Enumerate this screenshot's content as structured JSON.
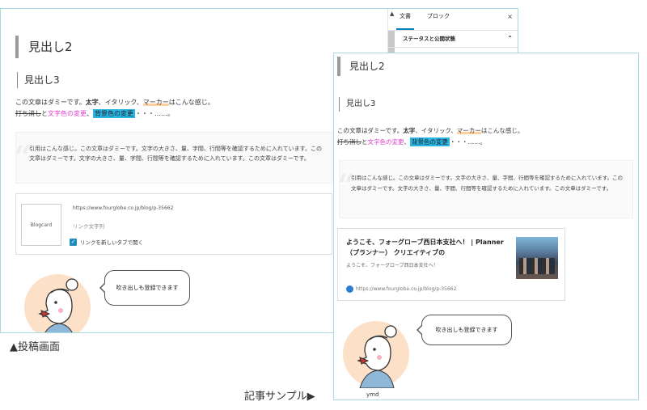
{
  "editor": {
    "heading2": "見出し2",
    "heading3": "見出し3",
    "paragraph1": {
      "a": "この文章はダミーです。",
      "bold": "太字",
      "b": "、イタリック、",
      "marker": "マーカー",
      "c": "はこんな感じ。"
    },
    "paragraph2": {
      "strike": "打ち消し",
      "a": "と",
      "color": "文字色の変更",
      "b": "、",
      "bg": "背景色の変更",
      "c": "・・・……。"
    },
    "quote": "引用はこんな感じ。この文章はダミーです。文字の大きさ、量、字間、行間等を確認するために入れています。この文章はダミーです。文字の大きさ、量、字間、行間等を確認するために入れています。この文章はダミーです。",
    "blogcard": {
      "thumb_label": "Blogcard",
      "url": "https://www.fourglobe.co.jp/blog/p-35662",
      "link_text": "リンク文字列",
      "checkbox_label": "リンクを新しいタブで開く"
    },
    "speech": "吹き出しも登録できます",
    "sidebar": {
      "tab_doc": "文書",
      "tab_block": "ブロック",
      "close": "×",
      "section": "ステータスと公開状態"
    }
  },
  "caption_post": "▲投稿画面",
  "sample": {
    "heading2": "見出し2",
    "heading3": "見出し3",
    "paragraph1": {
      "a": "この文章はダミーです。",
      "bold": "太字",
      "b": "、イタリック、",
      "marker": "マーカー",
      "c": "はこんな感じ。"
    },
    "paragraph2": {
      "strike": "打ち消し",
      "a": "と",
      "color": "文字色の変更",
      "b": "、",
      "bg": "背景色の変更",
      "c": "・・・……。"
    },
    "quote": "引用はこんな感じ。この文章はダミーです。文字の大きさ、量、字間、行間等を確認するために入れています。この文章はダミーです。文字の大きさ、量、字間、行間等を確認するために入れています。この文章はダミーです。",
    "card": {
      "title": "ようこそ、フォーグローブ西日本支社へ！ | Planner（プランナー） クリエイティブの",
      "desc": "ようこそ、フォーグローブ西日本支社へ！",
      "url": "https://www.fourglobe.co.jp/blog/p-35662"
    },
    "speech": "吹き出しも登録できます",
    "name": "ymd"
  },
  "caption_sample": "記事サンプル▶",
  "colors": {
    "accent": "#a8dbe8",
    "highlight": "#29b6e6",
    "magenta": "#e040d0",
    "marker": "#ffcf9e"
  }
}
